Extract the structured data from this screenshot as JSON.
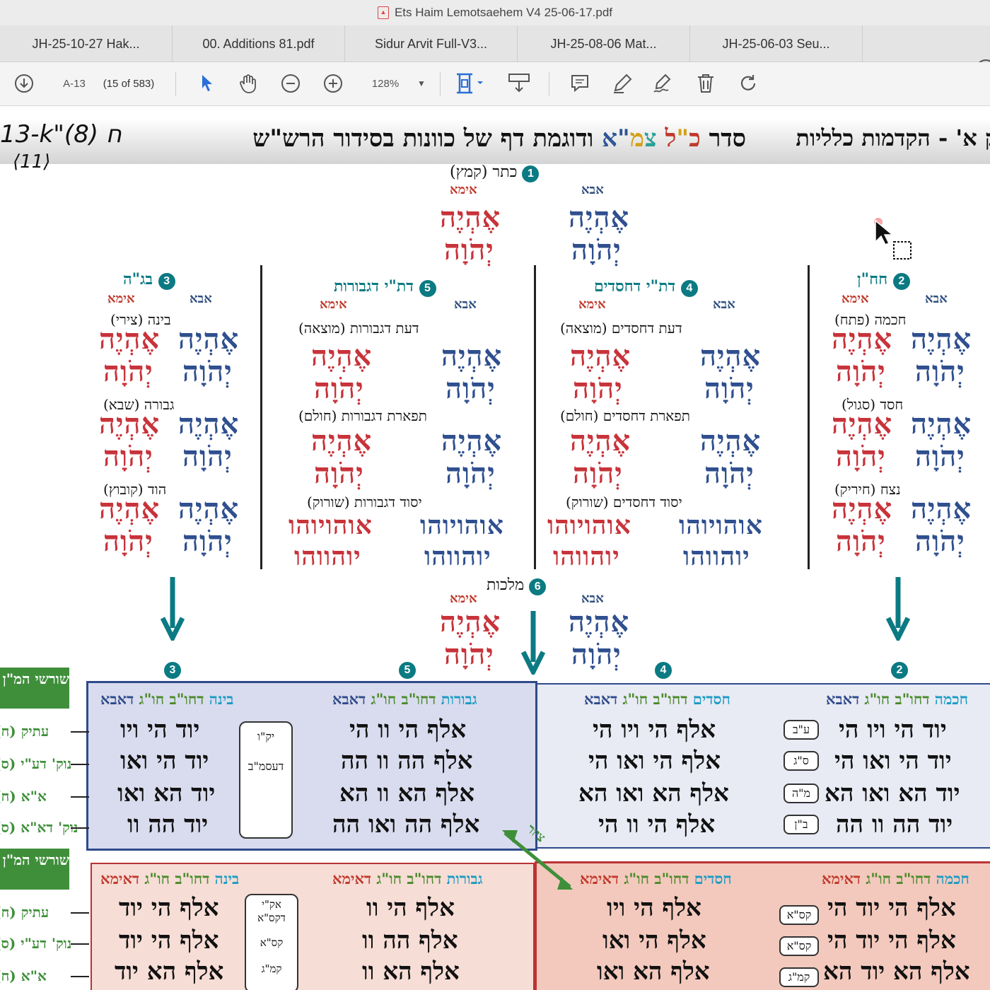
{
  "window": {
    "title": "Ets Haim Lemotsaehem V4 25-06-17.pdf"
  },
  "tabs": [
    "JH-25-10-27 Hak...",
    "00. Additions 81.pdf",
    "Sidur Arvit Full-V3...",
    "JH-25-08-06 Mat...",
    "JH-25-06-03 Seu..."
  ],
  "help_label": "?",
  "toolbar": {
    "page_label": "A-13",
    "page_count": "(15 of 583)",
    "zoom": "128%"
  },
  "doc": {
    "hand_note": "13-k\"ח (8)",
    "hand_note2": "⟨11⟩",
    "title_parts": [
      "סדר ",
      "כ",
      "\"",
      "ל ",
      "צ",
      "מ",
      "\"",
      "א",
      " ודוגמת דף של כוונות בסידור הרש\"ש"
    ],
    "section_title": "ק א' - הקדמות כלליות",
    "abba": "אבא",
    "ima": "אימא",
    "ehyeh_a": "אֶהְיֶה",
    "yhvh_a": "יְהֹוָה",
    "keter": {
      "num": "1",
      "label": "כתר (קמץ)"
    },
    "malchut": {
      "num": "6",
      "label": "מלכות"
    },
    "columns": [
      {
        "num": "2",
        "label": "חח\"ן",
        "items": [
          "חכמה (פתח)",
          "חסד (סגול)",
          "נצח (חיריק)"
        ]
      },
      {
        "num": "4",
        "label": "דת\"י דחסדים",
        "items": [
          "דעת דחסדים (מוצאה)",
          "תפארת דחסדים (חולם)",
          "יסוד דחסדים (שורוק)"
        ]
      },
      {
        "num": "5",
        "label": "דת\"י דגבורות",
        "items": [
          "דעת דגבורות (מוצאה)",
          "תפארת דגבורות (חולם)",
          "יסוד דגבורות (שורוק)"
        ]
      },
      {
        "num": "3",
        "label": "בג\"ה",
        "items": [
          "בינה (צירי)",
          "גבורה (שבא)",
          "הוד (קובוץ)"
        ]
      }
    ],
    "yesod_names": {
      "abba_1": "אוהויוהו",
      "abba_2": "יוהווהו",
      "ima_1": "אוהויוהו",
      "ima_2": "יוהווהו"
    },
    "marker_nums": [
      "3",
      "5",
      "4",
      "2"
    ],
    "green_tags": [
      "שורשי המ\"ן (כללי)",
      "שורשי המ\"ן (כללי)"
    ],
    "side_labels_top": [
      "עתיק (ח)",
      "נוק' דע\"י (ס)",
      "א\"א (ח)",
      "נוק' דא\"א (ס)"
    ],
    "side_labels_bot": [
      "עתיק (ח)",
      "נוק' דע\"י (ס)",
      "א\"א (ח)"
    ],
    "abba_tables": [
      {
        "head": [
          "בינה",
          " דחו\"ב חו\"ג ",
          "דאבא"
        ],
        "rows": [
          "יוד הי ויו",
          "יוד הי ואו",
          "יוד הא ואו",
          "יוד הה וו"
        ],
        "box": [
          "יק\"ו",
          "דעסמ\"ב"
        ]
      },
      {
        "head": [
          "גבורות",
          " דחו\"ב חו\"ג ",
          "דאבא"
        ],
        "rows": [
          "אלף הי וו הי",
          "אלף הה וו הה",
          "אלף הא וו הא",
          "אלף הה ואו הה"
        ]
      },
      {
        "head": [
          "חסדים",
          " דחו\"ב חו\"ג ",
          "דאבא"
        ],
        "rows": [
          "אלף הי ויו הי",
          "אלף הי ואו הי",
          "אלף הא ואו הא",
          "אלף הי וו הי"
        ]
      },
      {
        "head": [
          "חכמה",
          " דחו\"ב חו\"ג ",
          "דאבא"
        ],
        "rows": [
          "יוד הי ויו הי",
          "יוד הי ואו הי",
          "יוד הא ואו הא",
          "יוד הה וו הה"
        ],
        "pills": [
          "ע\"ב",
          "ס\"ג",
          "מ\"ה",
          "ב\"ן"
        ]
      }
    ],
    "ima_tables": [
      {
        "head": [
          "בינה",
          " דחו\"ב חו\"ג ",
          "דאימא"
        ],
        "rows": [
          "אלף הי יוד",
          "אלף הי יוד",
          "אלף הא יוד"
        ],
        "box": [
          "אק\"י",
          "דקס\"א",
          "קס\"א",
          "קמ\"ג"
        ]
      },
      {
        "head": [
          "גבורות",
          " דחו\"ב חו\"ג ",
          "דאימא"
        ],
        "rows": [
          "אלף הי וו",
          "אלף הה וו",
          "אלף הא וו"
        ]
      },
      {
        "head": [
          "חסדים",
          " דחו\"ב חו\"ג ",
          "דאימא"
        ],
        "rows": [
          "אלף הי ויו",
          "אלף הי ואו",
          "אלף הא ואו"
        ]
      },
      {
        "head": [
          "חכמה",
          " דחו\"ב חו\"ג ",
          "דאימא"
        ],
        "rows": [
          "אלף הי יוד הי",
          "אלף הי יוד הי",
          "אלף הא יוד הא"
        ],
        "pills": [
          "קס\"א",
          "קס\"א",
          "קמ\"ג"
        ]
      }
    ],
    "cross_label": "ציור",
    "colors": {
      "abba": "#2f4f8f",
      "ima": "#c8333a",
      "teal": "#0b7a83",
      "green": "#3f8f3a"
    }
  }
}
